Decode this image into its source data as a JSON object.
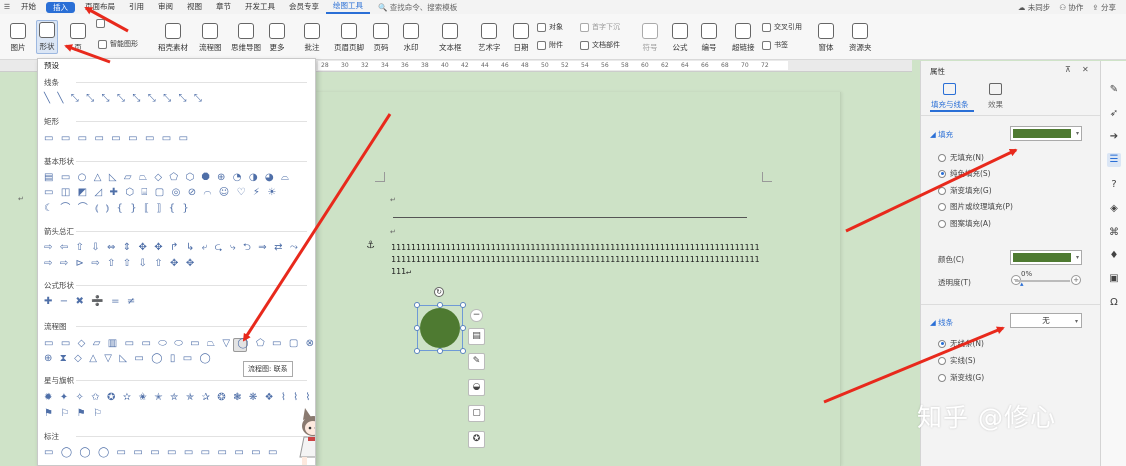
{
  "menubar": {
    "menu_icon": "☰",
    "tabs": [
      "开始",
      "插入",
      "页面布局",
      "引用",
      "审阅",
      "视图",
      "章节",
      "开发工具",
      "会员专享"
    ],
    "active_tab": "插入",
    "context_tab": "绘图工具",
    "search_text": "查找命令、搜索模板",
    "right": [
      "未同步",
      "协作",
      "分享"
    ]
  },
  "ribbon": {
    "picture": "图片",
    "shape": "形状",
    "page": "页",
    "smartart": "智能图形",
    "material": "稻壳素材",
    "flowchart": "流程图",
    "mindmap": "思维导图",
    "more": "更多",
    "comment": "批注",
    "header_footer": "页眉页脚",
    "page_number": "页码",
    "watermark": "水印",
    "textbox": "文本框",
    "wordart": "艺术字",
    "date": "日期",
    "object": "对象",
    "attachment": "附件",
    "first_drop": "首字下沉",
    "doc_part": "文档部件",
    "symbol": "符号",
    "formula": "公式",
    "number": "编号",
    "hyperlink": "超链接",
    "crossref": "交叉引用",
    "bookmark": "书签",
    "window": "窗体",
    "resources": "资源夹"
  },
  "ruler": {
    "ticks": [
      "28",
      "30",
      "32",
      "34",
      "36",
      "38",
      "40",
      "42",
      "44",
      "46",
      "48",
      "50",
      "52",
      "54",
      "56",
      "58",
      "60",
      "62",
      "64",
      "66",
      "68",
      "70",
      "72"
    ]
  },
  "gallery": {
    "header": "预设",
    "sections": [
      {
        "title": "线条",
        "rows": [
          "╲ ╲ ⤡ ⤡ ⤡ ⤡ ⤡ ⤡ ⤡ ⤡ ⤡"
        ]
      },
      {
        "title": "矩形",
        "rows": [
          "▭ ▭ ▭ ▭ ▭ ▭ ▭ ▭ ▭"
        ]
      },
      {
        "title": "基本形状",
        "rows": [
          "▤ ▭ ○ △ ◺ ▱ ⏢ ◇ ⬠ ⬡ ⯃ ⊕ ◔ ◑ ◕ ⌓",
          "▭ ◫ ◩ ◿ ✚ ⬡ ⌸ ▢ ◎ ⊘ ⌒ ☺ ♡ ⚡ ☀",
          "☾ ⌒ ⌒ ⦅ ⦆ { } ⟦ ⟧ { }"
        ]
      },
      {
        "title": "箭头总汇",
        "rows": [
          "⇨ ⇦ ⇧ ⇩ ⇔ ⇕ ✥ ✥ ↱ ↳ ⤶ ⮎ ⤷ ⮌ ⇒ ⇄ ⤳",
          "⇨ ⇨ ⊳ ⇨ ⇧ ⇧ ⇩ ⇧ ✥ ✥"
        ]
      },
      {
        "title": "公式形状",
        "rows": [
          "✚ − ✖ ➗ = ≠"
        ]
      },
      {
        "title": "流程图",
        "rows": [
          "▭ ▭ ◇ ▱ ▥ ▭ ▭ ⬭ ⬭ ▭ ⏢ ▽ ◯ ⬠ ▭ ▢ ⊗",
          "⊕ ⧗ ◇ △ ▽ ◺ ▭ ◯ ▯ ▭ ◯"
        ]
      },
      {
        "title": "星与旗帜",
        "rows": [
          "✹ ✦ ✧ ✩ ✪ ✫ ✬ ✭ ✮ ✯ ✰ ❂ ❃ ❋ ❖ ⌇ ⌇ ⌇",
          "⚑ ⚐ ⚑ ⚐"
        ]
      },
      {
        "title": "标注",
        "rows": [
          "▭ ◯ ◯ ◯ ▭ ▭ ▭ ▭ ▭ ▭ ▭ ▭ ▭ ▭"
        ]
      }
    ],
    "tooltip": "流程图: 联系"
  },
  "document": {
    "paragraph_mark": "↵",
    "text": "1111111111111111111111111111111111111111111111111111111111111111111111111111111111111111111111111111111111111111111111111111111111111111111111111111111↵",
    "anchor": "⚓"
  },
  "shape_tools": [
    "−",
    "▤",
    "✎",
    "◒",
    "▢",
    "✪"
  ],
  "properties": {
    "title": "属性",
    "pin": "⊼",
    "close": "✕",
    "tabs": [
      "填充与线条",
      "效果"
    ],
    "fill": {
      "title": "◢ 填充",
      "color": "#4e7a31",
      "options": [
        "无填充(N)",
        "纯色填充(S)",
        "渐变填充(G)",
        "图片或纹理填充(P)",
        "图案填充(A)"
      ],
      "selected": 1,
      "color_label": "颜色(C)",
      "transparency_label": "透明度(T)",
      "transparency_value": "0%"
    },
    "line": {
      "title": "◢ 线条",
      "value": "无",
      "options": [
        "无线条(N)",
        "实线(S)",
        "渐变线(G)"
      ],
      "selected": 0
    }
  },
  "sidebar_icons": [
    "✎",
    "➶",
    "➔",
    "☰",
    "?",
    "◈",
    "⌘",
    "♦",
    "▣",
    "Ω"
  ],
  "watermark": "知乎 @修心",
  "colors": {
    "accent": "#2a6fd6",
    "fill": "#4e7a31",
    "arrow": "#e8291c",
    "page_bg": "#cfe3c8"
  }
}
